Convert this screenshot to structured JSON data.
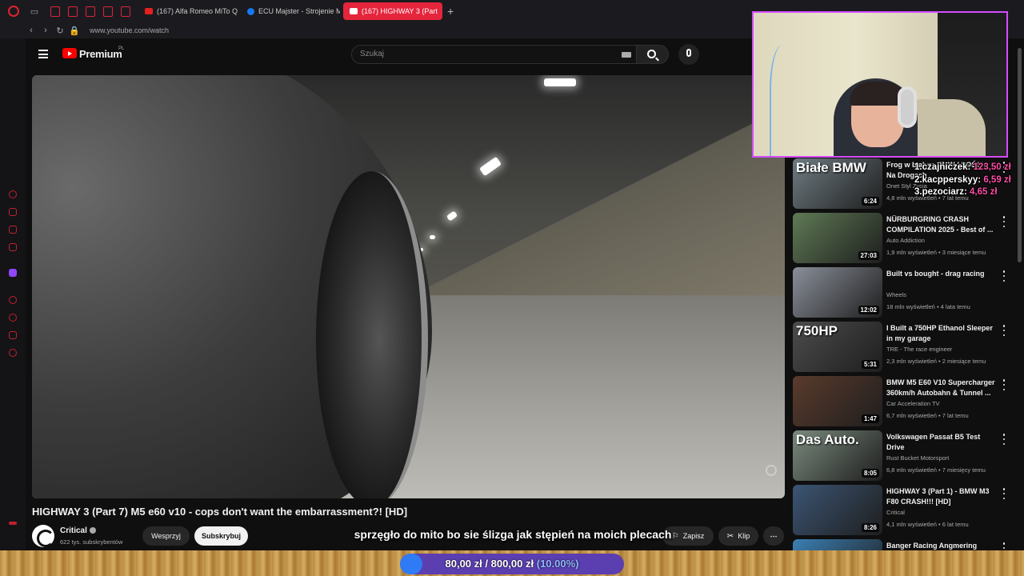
{
  "browser": {
    "tabs": [
      {
        "label": "(167) Alfa Romeo MiTo QV",
        "favicon": "youtube-icon",
        "active": false
      },
      {
        "label": "ECU Majster - Strojenie M",
        "favicon": "facebook-icon",
        "active": false
      },
      {
        "label": "(167) HIGHWAY 3 (Part",
        "favicon": "youtube-icon",
        "active": true
      }
    ],
    "url": "www.youtube.com/watch"
  },
  "youtube": {
    "brand": "Premium",
    "region": "PL",
    "search_placeholder": "Szukaj"
  },
  "video": {
    "title": "HIGHWAY 3 (Part 7) M5 e60 v10 - cops don't want the embarrassment?! [HD]",
    "channel": "Critical",
    "subscribers": "622 tys. subskrybentów",
    "support_label": "Wesprzyj",
    "subscribe_label": "Subskrybuj",
    "save_label": "Zapisz",
    "clip_label": "Klip"
  },
  "recommendations": [
    {
      "title": "Frog w białym BMW ( POŚCIG ) - Na Drogach",
      "channel": "Onet Styl Życia",
      "meta": "4,8 mln wyświetleń • 7 lat temu",
      "duration": "6:24",
      "thumb_text": "Białe BMW",
      "thumb_color": "#6f7c82"
    },
    {
      "title": "NÜRBURGRING CRASH COMPILATION 2025 - Best of ...",
      "channel": "Auto Addiction",
      "meta": "1,9 mln wyświetleń • 3 miesiące temu",
      "duration": "27:03",
      "thumb_text": "",
      "thumb_color": "#5f7a55"
    },
    {
      "title": "Built vs bought - drag racing",
      "channel": "Wheels",
      "meta": "18 mln wyświetleń • 4 lata temu",
      "duration": "12:02",
      "thumb_text": "",
      "thumb_color": "#8a8f99"
    },
    {
      "title": "I Built a 750HP Ethanol Sleeper in my garage",
      "channel": "TRE - The race engineer",
      "meta": "2,3 mln wyświetleń • 2 miesiące temu",
      "duration": "5:31",
      "thumb_text": "750HP",
      "thumb_color": "#4c4c4c"
    },
    {
      "title": "BMW M5 E60 V10 Supercharger 360km/h Autobahn & Tunnel ...",
      "channel": "Car Acceleration TV",
      "meta": "6,7 mln wyświetleń • 7 lat temu",
      "duration": "1:47",
      "thumb_text": "",
      "thumb_color": "#5a3b2c"
    },
    {
      "title": "Volkswagen Passat B5 Test Drive",
      "channel": "Rust Bucket Motorsport",
      "meta": "6,8 mln wyświetleń • 7 miesięcy temu",
      "duration": "8:05",
      "thumb_text": "Das Auto.",
      "thumb_color": "#7b8a7e"
    },
    {
      "title": "HIGHWAY 3 (Part 1) - BMW M3 F80 CRASH!!! [HD]",
      "channel": "Critical",
      "meta": "4,1 mln wyświetleń • 6 lat temu",
      "duration": "8:26",
      "thumb_text": "",
      "thumb_color": "#3c5573"
    },
    {
      "title": "Banger Racing Angmering",
      "channel": "",
      "meta": "",
      "duration": "",
      "thumb_text": "",
      "thumb_color": "#3b7fb3"
    }
  ],
  "overlay": {
    "donors": [
      {
        "name": "1.czajniczek:",
        "amount": "123,50 zł"
      },
      {
        "name": "2.kacpperskyy:",
        "amount": "6,59 zł"
      },
      {
        "name": "3.pezociarz:",
        "amount": "4,65 zł"
      }
    ],
    "subtitle": "sprzęgło do mito bo sie ślizga jak stępień na moich plecach",
    "goal_current": "80,00 zł",
    "goal_target": "800,00 zł",
    "goal_percent_text": "(10.00%)",
    "goal_fraction": 0.1
  }
}
